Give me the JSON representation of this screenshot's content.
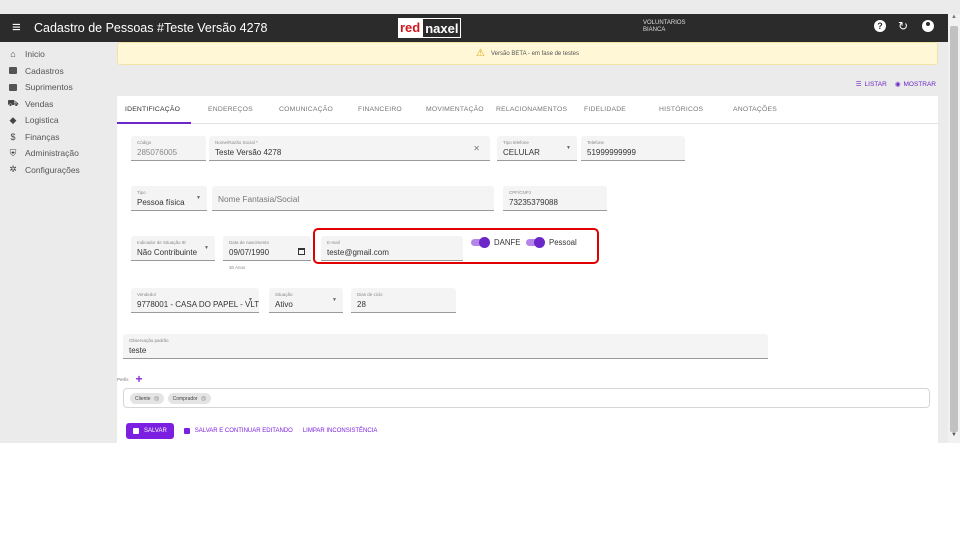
{
  "header": {
    "title": "Cadastro de Pessoas #Teste Versão 4278",
    "logo_red": "red",
    "logo_naxel": "naxel",
    "org_line1": "VOLUNTARIOS",
    "org_line2": "BIANCA",
    "icons": [
      "menu-icon",
      "help-icon",
      "refresh-icon",
      "user-icon"
    ]
  },
  "sidebar": {
    "items": [
      {
        "label": "Inicio",
        "icon": "home-icon"
      },
      {
        "label": "Cadastros",
        "icon": "folder-icon"
      },
      {
        "label": "Suprimentos",
        "icon": "briefcase-icon"
      },
      {
        "label": "Vendas",
        "icon": "cart-icon"
      },
      {
        "label": "Logistica",
        "icon": "diamond-icon"
      },
      {
        "label": "Finanças",
        "icon": "dollar-icon"
      },
      {
        "label": "Administração",
        "icon": "shield-icon"
      },
      {
        "label": "Configurações",
        "icon": "gear-icon"
      }
    ]
  },
  "banner": {
    "text": "Versão BETA - em fase de testes"
  },
  "actions": {
    "listar": "LISTAR",
    "mostrar": "MOSTRAR"
  },
  "tabs": [
    "IDENTIFICAÇÃO",
    "ENDEREÇOS",
    "COMUNICAÇÃO",
    "FINANCEIRO",
    "MOVIMENTAÇÃO",
    "RELACIONAMENTOS",
    "FIDELIDADE",
    "HISTÓRICOS",
    "ANOTAÇÕES"
  ],
  "form": {
    "codigo": {
      "label": "Código",
      "value": "285076005"
    },
    "nome": {
      "label": "Nome/Razão Social *",
      "value": "Teste Versão 4278"
    },
    "tipo_telefone": {
      "label": "Tipo telefone",
      "value": "CELULAR"
    },
    "telefone": {
      "label": "Telefone",
      "value": "51999999999"
    },
    "tipo": {
      "label": "Tipo",
      "value": "Pessoa física"
    },
    "nome_fantasia": {
      "placeholder": "Nome Fantasia/Social"
    },
    "cpf": {
      "label": "CPF/CNPJ",
      "value": "73235379088"
    },
    "indicador_ie": {
      "label": "Indicador de Situação IE",
      "value": "Não Contribuinte"
    },
    "nascimento": {
      "label": "Data de nascimento",
      "value": "09/07/1990",
      "hint": "30 Anos"
    },
    "email": {
      "label": "E-mail",
      "value": "teste@gmail.com"
    },
    "danfe": {
      "label": "DANFE",
      "checked": true
    },
    "pessoal": {
      "label": "Pessoal",
      "checked": true
    },
    "vendedor": {
      "label": "Vendedor",
      "value": "9778001 - CASA DO PAPEL - VLT"
    },
    "situacao": {
      "label": "Situação",
      "value": "Ativo"
    },
    "dias_ciclo": {
      "label": "Dias de ciclo",
      "value": "28"
    },
    "observacao": {
      "label": "Observação padrão",
      "value": "teste"
    },
    "perfis_label": "Perfis",
    "perfis": [
      "Cliente",
      "Comprador"
    ]
  },
  "buttons": {
    "salvar": "SALVAR",
    "salvar_continuar": "SALVAR E CONTINUAR EDITANDO",
    "limpar": "LIMPAR INCONSISTÊNCIA"
  },
  "colors": {
    "accent": "#6b27c7",
    "topbar": "#2b2b2b",
    "highlight": "#e00000"
  }
}
